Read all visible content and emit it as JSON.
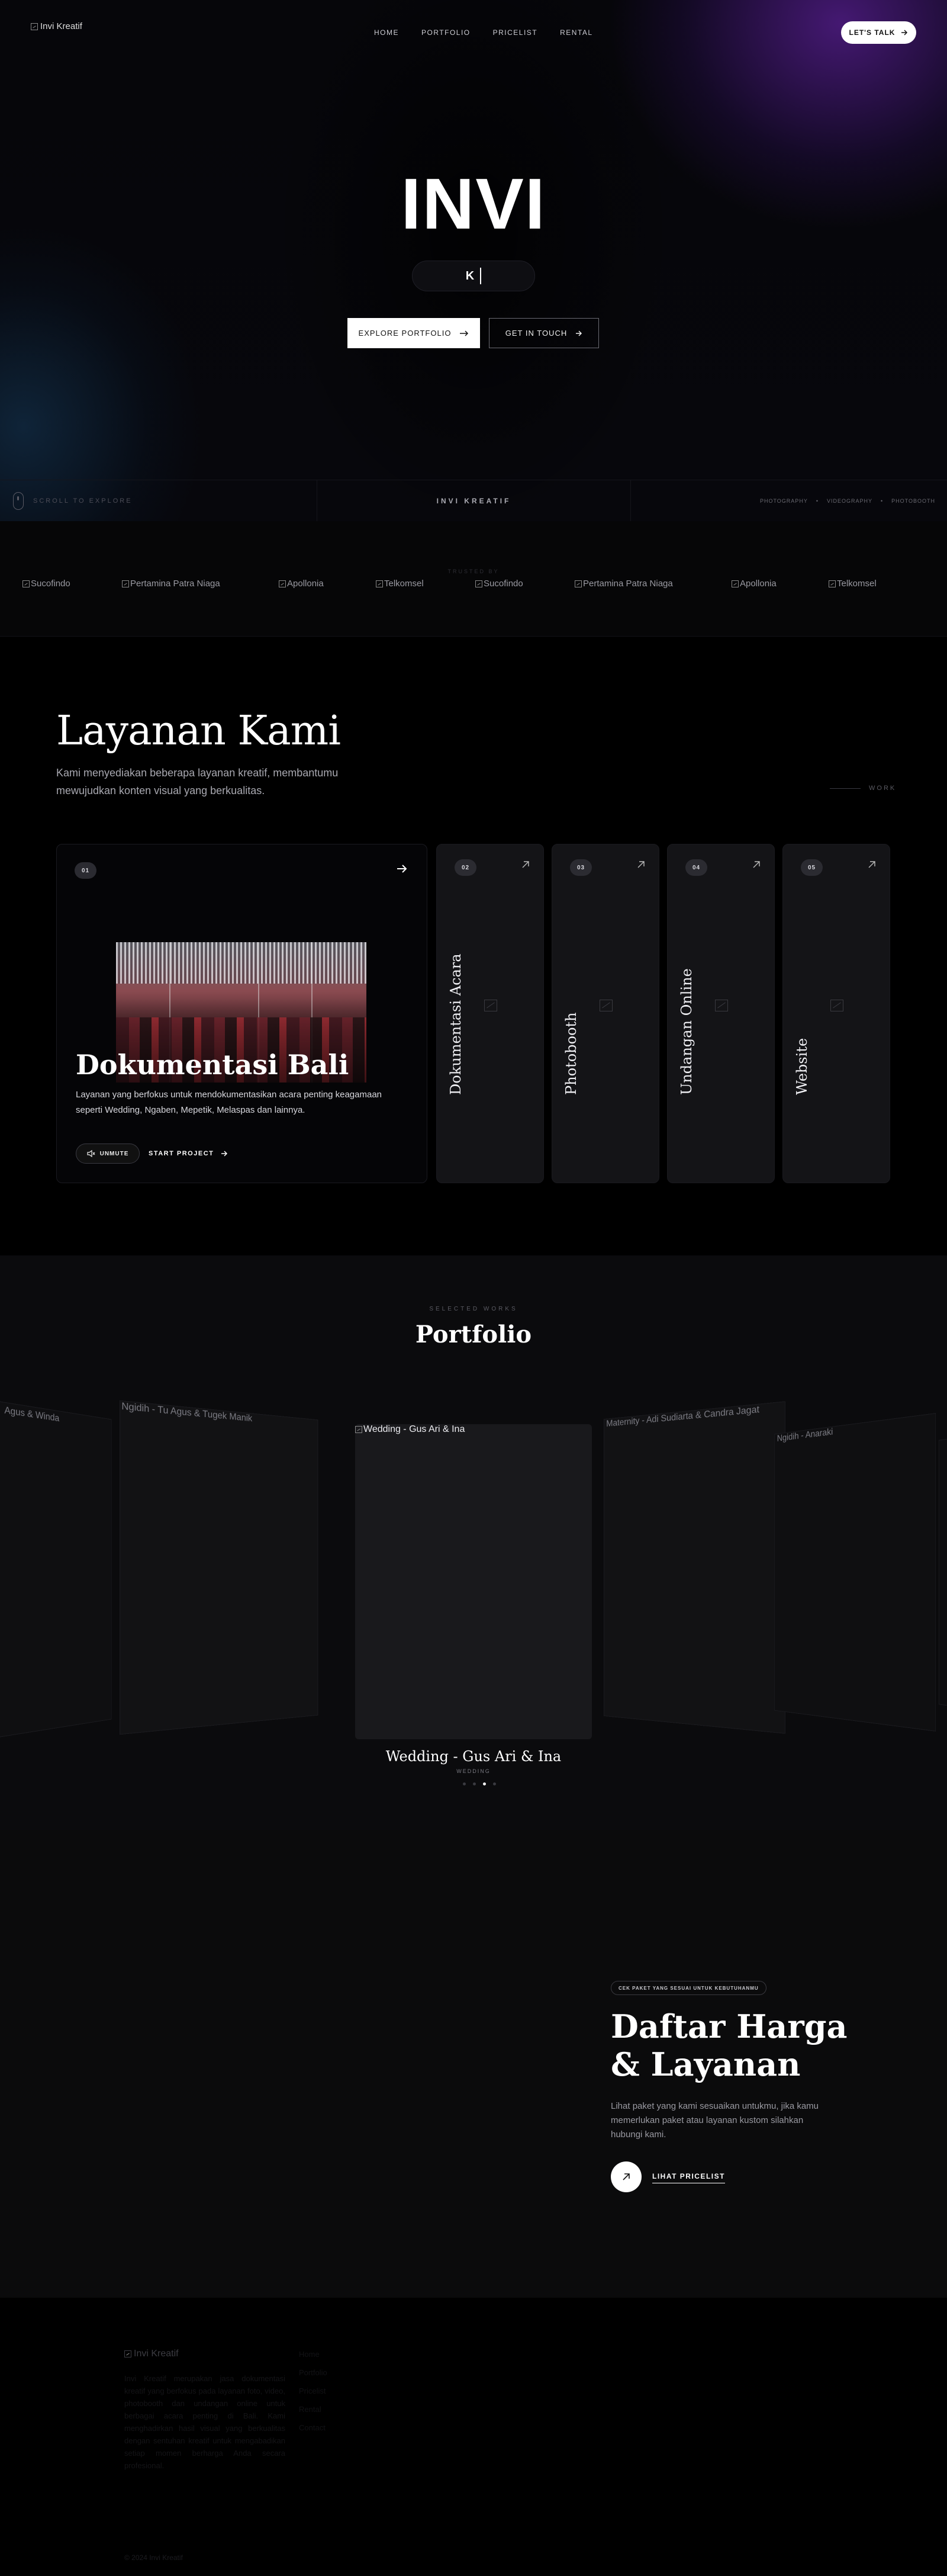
{
  "brand": {
    "logo_alt": "Invi Kreatif",
    "name": "INVI",
    "typing": "K"
  },
  "nav": {
    "items": [
      "HOME",
      "PORTFOLIO",
      "PRICELIST",
      "RENTAL"
    ],
    "cta": "LET'S TALK"
  },
  "hero": {
    "primary_button": "EXPLORE PORTFOLIO",
    "secondary_button": "GET IN TOUCH",
    "scroll_text": "SCROLL TO EXPLORE",
    "center_label": "INVI KREATIF",
    "services": [
      "PHOTOGRAPHY",
      "VIDEOGRAPHY",
      "PHOTOBOOTH"
    ]
  },
  "clients": {
    "label": "TRUSTED BY",
    "items": [
      "Sucofindo",
      "Pertamina Patra Niaga",
      "Apollonia",
      "Telkomsel",
      "Sucofindo",
      "Pertamina Patra Niaga",
      "Apollonia",
      "Telkomsel"
    ]
  },
  "layanan": {
    "title": "Layanan Kami",
    "description": "Kami menyediakan beberapa layanan kreatif, membantumu mewujudkan konten visual yang berkualitas.",
    "work_label": "WORK",
    "featured": {
      "number": "01",
      "title": "Dokumentasi Bali",
      "description": "Layanan yang berfokus untuk mendokumentasikan acara penting keagamaan seperti Wedding, Ngaben, Mepetik, Melaspas dan lainnya.",
      "unmute": "UNMUTE",
      "start": "START PROJECT"
    },
    "cards": [
      {
        "number": "02",
        "title": "Dokumentasi Acara"
      },
      {
        "number": "03",
        "title": "Photobooth"
      },
      {
        "number": "04",
        "title": "Undangan Online"
      },
      {
        "number": "05",
        "title": "Website"
      }
    ]
  },
  "portfolio": {
    "eyebrow": "SELECTED WORKS",
    "title": "Portfolio",
    "items": [
      "Agus & Winda",
      "Ngidih - Tu Agus & Tugek Manik",
      "Wedding - Gus Ari & Ina",
      "Maternity - Adi Sudiarta & Candra Jagat",
      "Ngidih - Anaraki"
    ],
    "active_title": "Wedding - Gus Ari & Ina",
    "active_category": "WEDDING"
  },
  "pricelist": {
    "badge": "CEK PAKET YANG SESUAI UNTUK KEBUTUHANMU",
    "title": "Daftar Harga & Layanan",
    "description": "Lihat paket yang kami sesuaikan untukmu, jika kamu memerlukan paket atau layanan kustom silahkan hubungi kami.",
    "link": "LIHAT PRICELIST"
  },
  "footer": {
    "logo_alt": "Invi Kreatif",
    "description": "Invi Kreatif merupakan jasa dokumentasi kreatif yang berfokus pada layanan foto, video, photobooth dan undangan online untuk berbagai acara penting di Bali. Kami menghadirkan hasil visual yang berkualitas dengan sentuhan kreatif untuk mengabadikan setiap momen berharga Anda secara profesional.",
    "links": [
      "Home",
      "Portfolio",
      "Pricelist",
      "Rental",
      "Contact"
    ],
    "copyright": "© 2024 Invi Kreatif"
  }
}
